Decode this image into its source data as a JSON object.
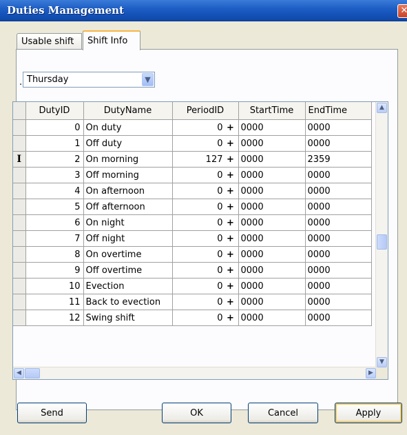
{
  "window": {
    "title": "Duties Management",
    "close_glyph": "✕"
  },
  "tabs": [
    {
      "label": "Usable shift",
      "active": false
    },
    {
      "label": "Shift Info",
      "active": true
    }
  ],
  "day_prefix": ".",
  "day_select": {
    "value": "Thursday"
  },
  "table": {
    "columns": [
      "DutyID",
      "DutyName",
      "PeriodID",
      "StartTime",
      "EndTime"
    ],
    "rows": [
      {
        "id": "0",
        "name": "On duty",
        "period": "0",
        "start": "0000",
        "end": "0000"
      },
      {
        "id": "1",
        "name": "Off duty",
        "period": "0",
        "start": "0000",
        "end": "0000"
      },
      {
        "id": "2",
        "name": "On morning",
        "period": "127",
        "start": "0000",
        "end": "2359"
      },
      {
        "id": "3",
        "name": "Off morning",
        "period": "0",
        "start": "0000",
        "end": "0000"
      },
      {
        "id": "4",
        "name": "On afternoon",
        "period": "0",
        "start": "0000",
        "end": "0000"
      },
      {
        "id": "5",
        "name": "Off afternoon",
        "period": "0",
        "start": "0000",
        "end": "0000"
      },
      {
        "id": "6",
        "name": "On night",
        "period": "0",
        "start": "0000",
        "end": "0000"
      },
      {
        "id": "7",
        "name": "Off night",
        "period": "0",
        "start": "0000",
        "end": "0000"
      },
      {
        "id": "8",
        "name": "On overtime",
        "period": "0",
        "start": "0000",
        "end": "0000"
      },
      {
        "id": "9",
        "name": "Off overtime",
        "period": "0",
        "start": "0000",
        "end": "0000"
      },
      {
        "id": "10",
        "name": "Evection",
        "period": "0",
        "start": "0000",
        "end": "0000"
      },
      {
        "id": "11",
        "name": "Back to evection",
        "period": "0",
        "start": "0000",
        "end": "0000"
      },
      {
        "id": "12",
        "name": "Swing shift",
        "period": "0",
        "start": "0000",
        "end": "0000"
      }
    ],
    "row_cursor_glyph": "I",
    "period_marker": "+"
  },
  "buttons": {
    "send": "Send",
    "ok": "OK",
    "cancel": "Cancel",
    "apply": "Apply"
  },
  "colors": {
    "title_bar": "#1e5fc6",
    "dialog_bg": "#ece9d8",
    "active_tab_accent": "#f7b643",
    "default_button_glow": "#f0c75d"
  }
}
